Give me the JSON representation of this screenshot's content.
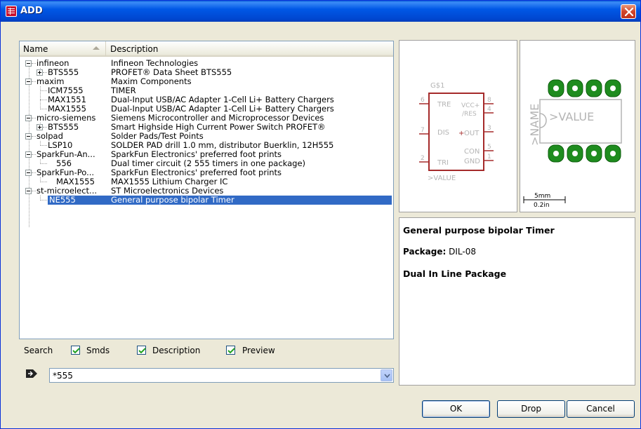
{
  "window": {
    "title": "ADD"
  },
  "list": {
    "columns": {
      "name": "Name",
      "description": "Description"
    },
    "rows": [
      {
        "name": "infineon",
        "description": "Infineon Technologies"
      },
      {
        "name": "BTS555",
        "description": "PROFET® Data Sheet BTS555"
      },
      {
        "name": "maxim",
        "description": "Maxim Components"
      },
      {
        "name": "ICM7555",
        "description": "TIMER"
      },
      {
        "name": "MAX1551",
        "description": "Dual-Input USB/AC Adapter 1-Cell Li+ Battery Chargers"
      },
      {
        "name": "MAX1555",
        "description": "Dual-Input USB/AC Adapter 1-Cell Li+ Battery Chargers"
      },
      {
        "name": "micro-siemens",
        "description": "Siemens Microcontroller and Microprocessor Devices"
      },
      {
        "name": "BTS555",
        "description": "Smart Highside High Current Power Switch PROFET®"
      },
      {
        "name": "solpad",
        "description": "Solder Pads/Test Points"
      },
      {
        "name": "LSP10",
        "description": "SOLDER PAD drill 1.0 mm, distributor Buerklin, 12H555"
      },
      {
        "name": "SparkFun-An...",
        "description": "SparkFun Electronics' preferred foot prints"
      },
      {
        "name": "556",
        "description": "Dual timer circuit (2 555 timers in one package)"
      },
      {
        "name": "SparkFun-Po...",
        "description": "SparkFun Electronics' preferred foot prints"
      },
      {
        "name": "MAX1555",
        "description": "MAX1555 Lithium Charger IC"
      },
      {
        "name": "st-microelect...",
        "description": "ST Microelectronics Devices"
      },
      {
        "name": "NE555",
        "description": "General purpose bipolar Timer"
      }
    ]
  },
  "search": {
    "label": "Search",
    "options": [
      {
        "label": "Smds",
        "checked": true
      },
      {
        "label": "Description",
        "checked": true
      },
      {
        "label": "Preview",
        "checked": true
      }
    ],
    "value": "*555"
  },
  "symbol": {
    "gate": "G$1",
    "value_label": ">VALUE",
    "pins": [
      {
        "num": "6",
        "name": "TRE"
      },
      {
        "num": "7",
        "name": "DIS"
      },
      {
        "num": "2",
        "name": "TRI"
      },
      {
        "num": "8",
        "name": "VCC+"
      },
      {
        "num": "4",
        "name": "/RES"
      },
      {
        "num": "3",
        "name": "OUT"
      },
      {
        "num": "5",
        "name": "CON"
      },
      {
        "num": "1",
        "name": "GND"
      }
    ]
  },
  "package": {
    "name_label": ">NAME",
    "value_label": ">VALUE",
    "scale_mm": "5mm",
    "scale_in": "0.2in"
  },
  "details": {
    "title": "General purpose bipolar Timer",
    "package_key": "Package:",
    "package_value": "DIL-08",
    "package_long": "Dual In Line Package"
  },
  "buttons": {
    "ok": "OK",
    "drop": "Drop",
    "cancel": "Cancel"
  },
  "colors": {
    "titlebar": "#0058e6",
    "selection": "#316ac5",
    "symbol_outline": "#a52a2a",
    "pad_green": "#1e8c1e"
  }
}
